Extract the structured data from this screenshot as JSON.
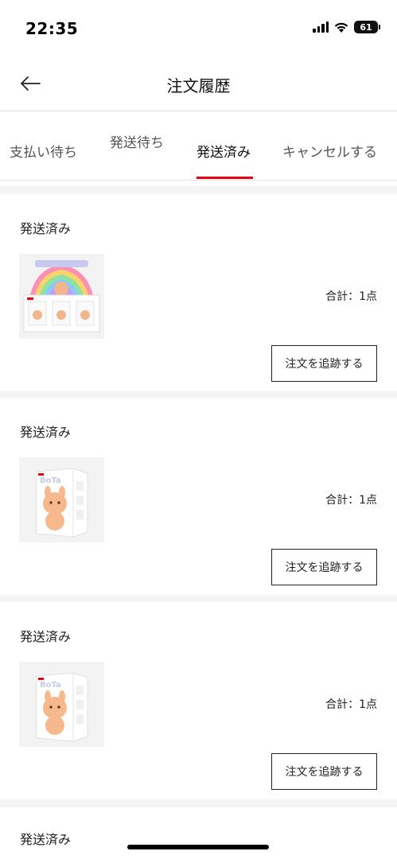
{
  "status_bar": {
    "time": "22:35",
    "battery": "61"
  },
  "header": {
    "title": "注文履歴",
    "back_icon": "arrow-left-icon"
  },
  "tabs": [
    {
      "label": "支払い待ち",
      "active": false
    },
    {
      "label": "発送待ち",
      "active": false
    },
    {
      "label": "発送済み",
      "active": true
    },
    {
      "label": "キャンセルする",
      "active": false
    }
  ],
  "accent_color": "#e60012",
  "orders": [
    {
      "status": "発送済み",
      "total": "合計：1点",
      "button": "注文を追跡する",
      "image": "product-display-box-image"
    },
    {
      "status": "発送済み",
      "total": "合計：1点",
      "button": "注文を追跡する",
      "image": "product-blind-box-image"
    },
    {
      "status": "発送済み",
      "total": "合計：1点",
      "button": "注文を追跡する",
      "image": "product-blind-box-image"
    },
    {
      "status": "発送済み"
    }
  ]
}
